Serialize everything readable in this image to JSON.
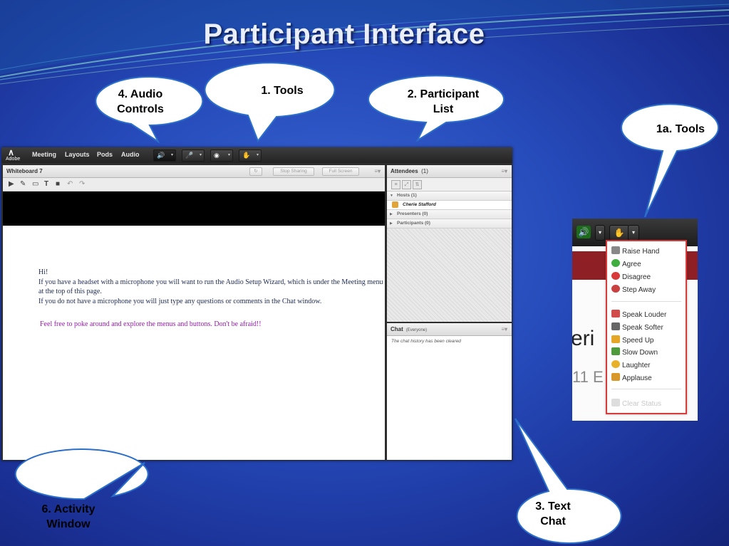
{
  "slide": {
    "title": "Participant Interface"
  },
  "callouts": {
    "audio": [
      "4.  Audio",
      "Controls"
    ],
    "tools": [
      "1. Tools"
    ],
    "participant_list": [
      "2. Participant",
      "List"
    ],
    "tools_1a": [
      "1a. Tools"
    ],
    "activity": [
      "6. Activity",
      "Window"
    ],
    "text_chat": [
      "3. Text",
      "Chat"
    ]
  },
  "app": {
    "logo_text": "Adobe",
    "menu": [
      "Meeting",
      "Layouts",
      "Pods",
      "Audio"
    ],
    "toolbar": [
      {
        "icon": "speaker-icon",
        "state": "active"
      },
      {
        "icon": "microphone-icon"
      },
      {
        "icon": "webcam-icon"
      },
      {
        "icon": "raise-hand-icon"
      }
    ],
    "whiteboard": {
      "title": "Whiteboard 7",
      "stop_sharing": "Stop Sharing",
      "full_screen": "Full Screen",
      "tools": [
        "pointer-icon",
        "pen-icon",
        "eraser-icon",
        "text-icon",
        "shape-icon",
        "undo-icon",
        "redo-icon"
      ],
      "lines": [
        "Hi!",
        "If you have a headset with a microphone you will want to run the Audio Setup Wizard, which is under the Meeting menu",
        "at the top of this page.",
        "If you do not have a microphone you will just type any questions or comments in the Chat window."
      ],
      "highlight": "Feel free to poke around and explore the menus and buttons. Don't be afraid!!",
      "highlight_color": "#9b1ab3"
    },
    "attendees": {
      "title": "Attendees",
      "count": "(1)",
      "hosts": "Hosts (1)",
      "host_name": "Cherie Stafford",
      "presenters": "Presenters (0)",
      "participants": "Participants (0)"
    },
    "chat": {
      "title": "Chat",
      "scope": "(Everyone)",
      "message": "The chat history has been cleared"
    }
  },
  "inset": {
    "status_menu": [
      {
        "label": "Raise Hand",
        "icon": "raise-hand-icon",
        "color": "#7a7a7a"
      },
      {
        "label": "Agree",
        "icon": "agree-icon",
        "color": "#3fae3f"
      },
      {
        "label": "Disagree",
        "icon": "disagree-icon",
        "color": "#d83a3a"
      },
      {
        "label": "Step Away",
        "icon": "step-away-icon",
        "color": "#c94040"
      }
    ],
    "feedback_menu": [
      {
        "label": "Speak Louder",
        "icon": "speak-louder-icon",
        "color": "#d24b4b"
      },
      {
        "label": "Speak Softer",
        "icon": "speak-softer-icon",
        "color": "#666666"
      },
      {
        "label": "Speed Up",
        "icon": "speed-up-icon",
        "color": "#e5a526"
      },
      {
        "label": "Slow Down",
        "icon": "slow-down-icon",
        "color": "#4f9a3c"
      },
      {
        "label": "Laughter",
        "icon": "laughter-icon",
        "color": "#e8b12a"
      },
      {
        "label": "Applause",
        "icon": "applause-icon",
        "color": "#d9992a"
      }
    ],
    "clear_status": "Clear Status",
    "bg_text_1": "eri",
    "bg_text_2": "11 E"
  }
}
